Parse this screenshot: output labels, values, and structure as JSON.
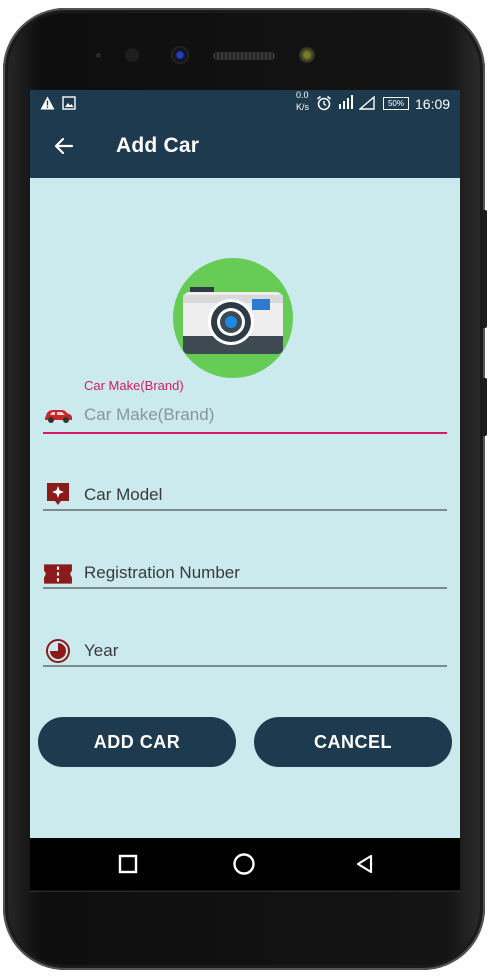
{
  "status_bar": {
    "network_speed_top": "0.0",
    "network_speed_unit": "K/s",
    "battery_percent": "50%",
    "time": "16:09",
    "icons": [
      "warning-icon",
      "image-icon",
      "alarm-icon",
      "signal-icon",
      "cell-signal-icon",
      "battery-icon"
    ]
  },
  "app_bar": {
    "title": "Add Car",
    "back_icon": "arrow-left-icon"
  },
  "photo_picker": {
    "icon": "camera-icon"
  },
  "form": {
    "car_make": {
      "floating_label": "Car Make(Brand)",
      "placeholder": "Car Make(Brand)",
      "icon": "car-icon"
    },
    "car_model": {
      "placeholder": "Car Model",
      "icon": "star-tag-icon"
    },
    "registration": {
      "placeholder": "Registration Number",
      "icon": "ticket-icon"
    },
    "year": {
      "placeholder": "Year",
      "icon": "clock-icon"
    }
  },
  "buttons": {
    "add_label": "ADD CAR",
    "cancel_label": "CANCEL"
  },
  "nav_bar": {
    "icons": [
      "recent-apps-icon",
      "home-icon",
      "back-icon"
    ]
  },
  "colors": {
    "primary": "#1d3a4f",
    "background": "#cbeaee",
    "accent": "#d81b60",
    "icon": "#8b1a1a",
    "camera_bg": "#66cc55"
  }
}
